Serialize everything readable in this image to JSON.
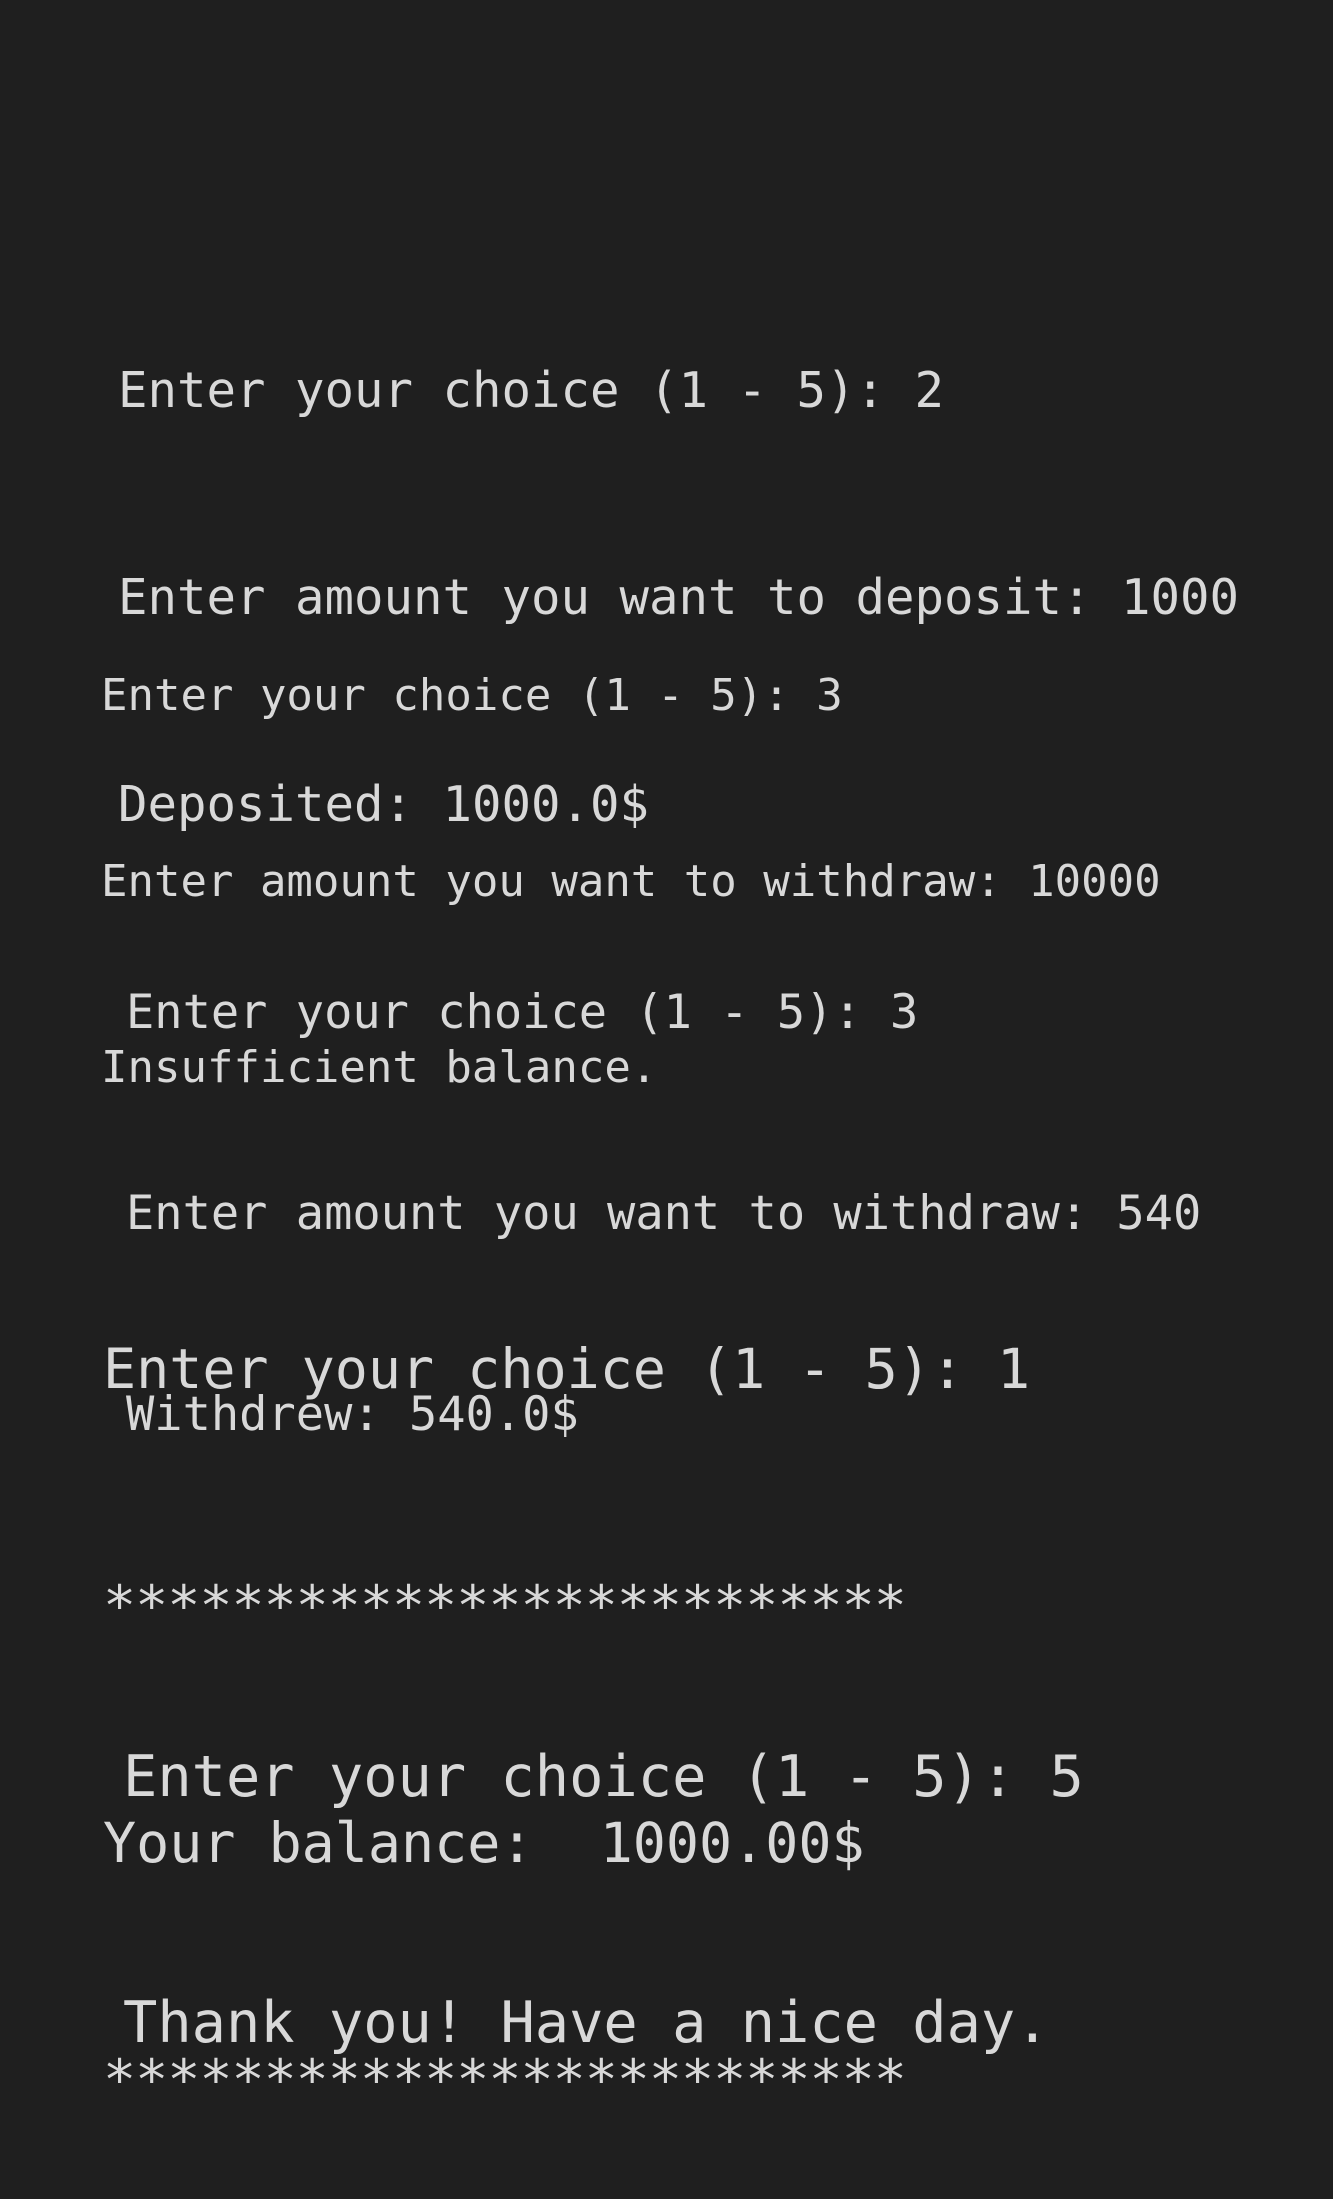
{
  "console": {
    "deposit_block": {
      "prompt": "Enter your choice (1 - 5): 2",
      "amount": "Enter amount you want to deposit: 1000",
      "result": "Deposited: 1000.0$"
    },
    "withdraw_fail_block": {
      "prompt": "Enter your choice (1 - 5): 3",
      "amount": "Enter amount you want to withdraw: 10000",
      "result": "Insufficient balance."
    },
    "withdraw_block": {
      "prompt": "Enter your choice (1 - 5): 3",
      "amount": "Enter amount you want to withdraw: 540",
      "result": "Withdrew: 540.0$"
    },
    "balance_block": {
      "prompt": "Enter your choice (1 - 5): 1",
      "separator_top": "*************************",
      "balance": "Your balance:  1000.00$",
      "separator_bottom": "*************************"
    },
    "exit_block": {
      "prompt": "Enter your choice (1 - 5): 5",
      "message": "Thank you! Have a nice day."
    }
  },
  "colors": {
    "background": "#1f1f1f",
    "text": "#d8d8d8"
  }
}
